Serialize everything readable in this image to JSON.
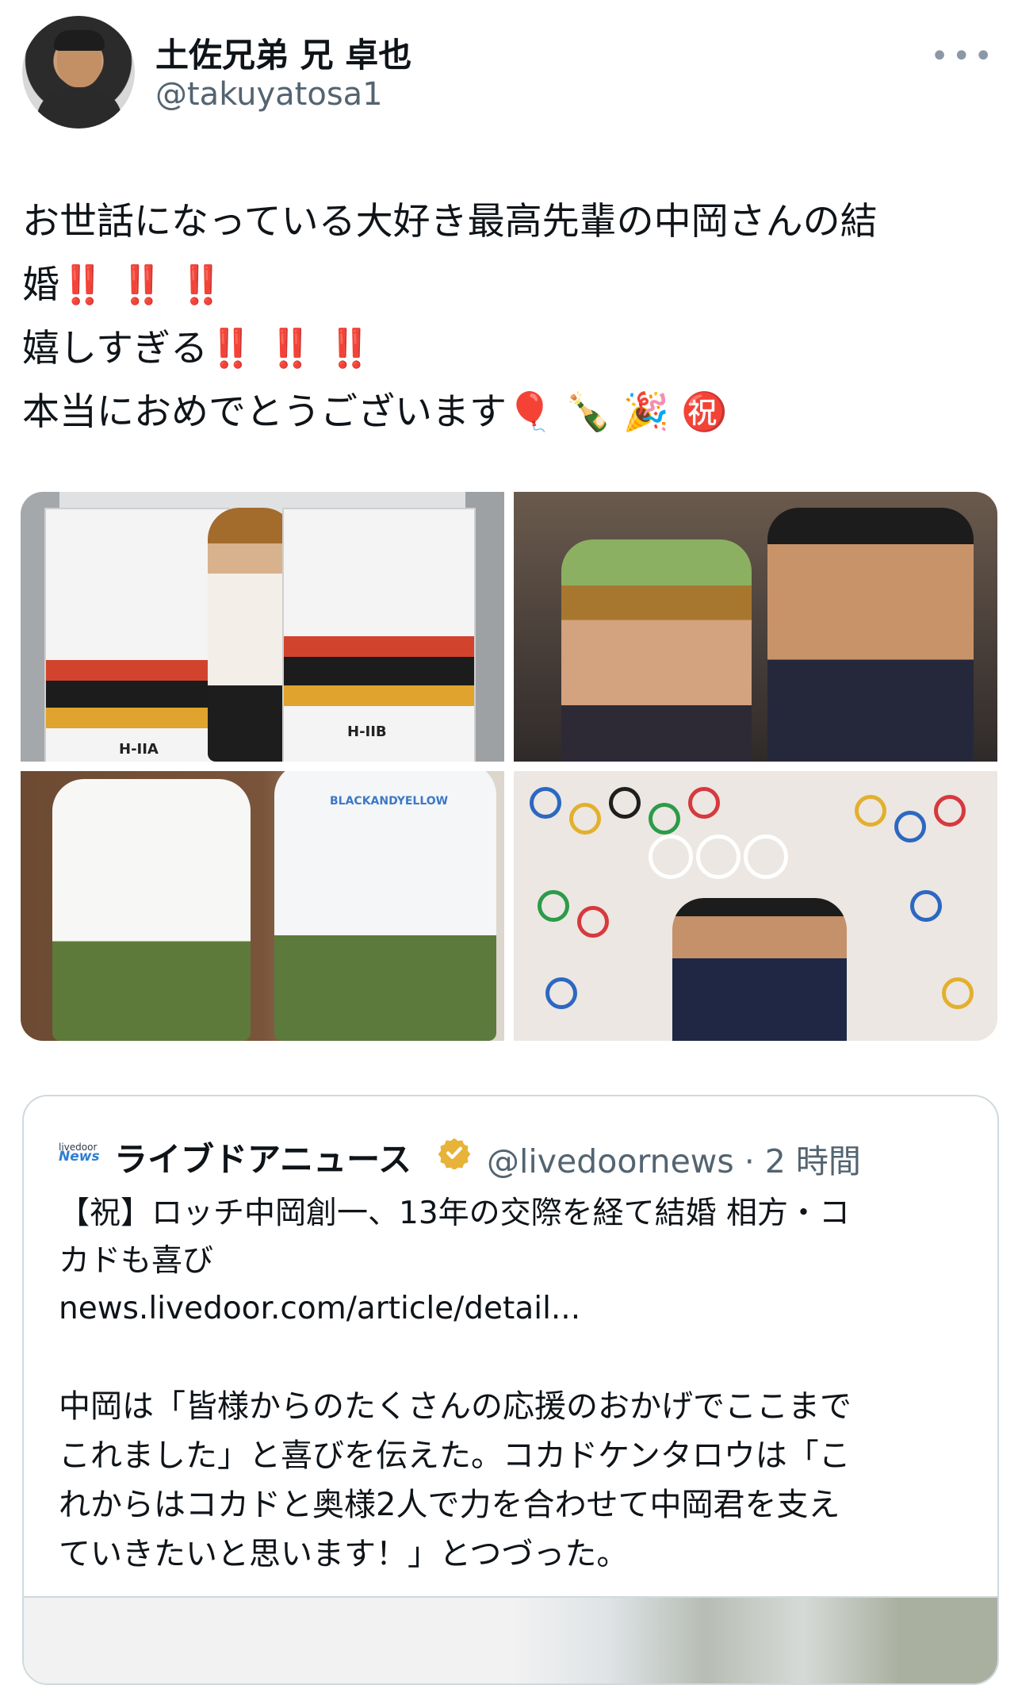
{
  "author": {
    "name": "土佐兄弟 兄 卓也",
    "handle": "@takuyatosa1",
    "more_icon": "more-horizontal-icon"
  },
  "tweet": {
    "line1": "お世話になっている大好き最高先輩の中岡さんの結",
    "line2_text": "婚",
    "line2_marks": "‼️ ‼️ ‼️",
    "line3_text": "嬉しすぎる",
    "line3_marks": "‼️ ‼️ ‼️",
    "line4_text": "本当におめでとうございます",
    "line4_emojis": "🎈 🍾 🎉 ㊗️"
  },
  "media": {
    "tile1_labels": [
      "H-IIA",
      "H-IIB"
    ],
    "tile3_shirt_text": "BLACKANDYELLOW"
  },
  "quote": {
    "logo_top": "livedoor",
    "logo_bottom": "News",
    "name": "ライブドアニュース",
    "handle_time": "@livedoornews · 2 時間",
    "headline": "【祝】ロッチ中岡創一、13年の交際を経て結婚 相方・コ\nカドも喜び\nnews.livedoor.com/article/detail...",
    "body": "中岡は「皆様からのたくさんの応援のおかげでここまで\nこれました」と喜びを伝えた。コカドケンタロウは「こ\nれからはコカドと奥様2人で力を合わせて中岡君を支え\nていきたいと思います！」とつづった。",
    "verified_icon": "verified-badge-icon"
  }
}
